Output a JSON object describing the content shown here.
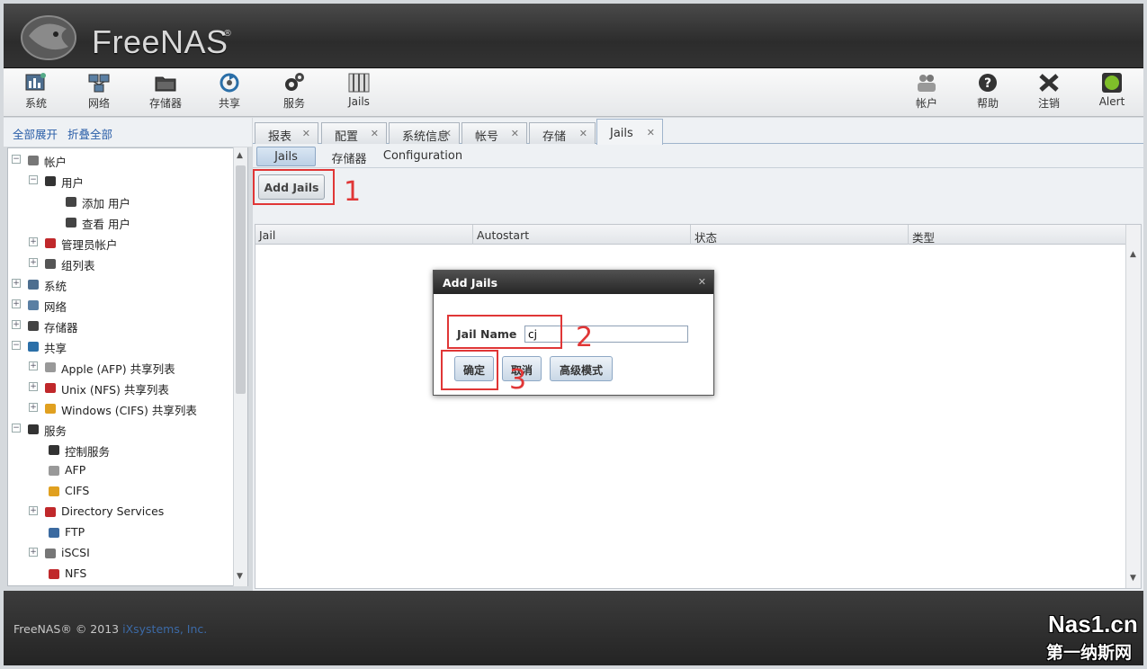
{
  "brand": {
    "logo_text": "FreeNAS",
    "registered": "®"
  },
  "toolbar": {
    "left": [
      {
        "label": "系统",
        "icon": "system-icon"
      },
      {
        "label": "网络",
        "icon": "network-icon"
      },
      {
        "label": "存储器",
        "icon": "storage-icon"
      },
      {
        "label": "共享",
        "icon": "sharing-icon"
      },
      {
        "label": "服务",
        "icon": "services-icon"
      },
      {
        "label": "Jails",
        "icon": "jails-icon"
      }
    ],
    "right": [
      {
        "label": "帐户",
        "icon": "account-icon"
      },
      {
        "label": "帮助",
        "icon": "help-icon"
      },
      {
        "label": "注销",
        "icon": "logout-icon"
      },
      {
        "label": "Alert",
        "icon": "alert-icon"
      }
    ]
  },
  "sidebar": {
    "expand_all": "全部展开",
    "collapse_all": "折叠全部",
    "tree": [
      {
        "label": "帐户",
        "expander": "-",
        "icon": "accounts-icon"
      },
      {
        "label": "用户",
        "expander": "-",
        "icon": "user-icon"
      },
      {
        "label": "添加 用户",
        "expander": "",
        "icon": "add-user-icon"
      },
      {
        "label": "查看 用户",
        "expander": "",
        "icon": "view-users-icon"
      },
      {
        "label": "管理员帐户",
        "expander": "+",
        "icon": "admin-icon"
      },
      {
        "label": "组列表",
        "expander": "+",
        "icon": "groups-icon"
      },
      {
        "label": "系统",
        "expander": "+",
        "icon": "system-icon"
      },
      {
        "label": "网络",
        "expander": "+",
        "icon": "network-icon"
      },
      {
        "label": "存储器",
        "expander": "+",
        "icon": "storage-icon"
      },
      {
        "label": "共享",
        "expander": "-",
        "icon": "sharing-icon"
      },
      {
        "label": "Apple (AFP) 共享列表",
        "expander": "+",
        "icon": "apple-icon"
      },
      {
        "label": "Unix (NFS) 共享列表",
        "expander": "+",
        "icon": "bsd-icon"
      },
      {
        "label": "Windows (CIFS) 共享列表",
        "expander": "+",
        "icon": "windows-icon"
      },
      {
        "label": "服务",
        "expander": "-",
        "icon": "services-icon"
      },
      {
        "label": "控制服务",
        "expander": "",
        "icon": "control-services-icon"
      },
      {
        "label": "AFP",
        "expander": "",
        "icon": "apple-icon"
      },
      {
        "label": "CIFS",
        "expander": "",
        "icon": "windows-icon"
      },
      {
        "label": "Directory Services",
        "expander": "+",
        "icon": "directory-icon"
      },
      {
        "label": "FTP",
        "expander": "",
        "icon": "ftp-icon"
      },
      {
        "label": "iSCSI",
        "expander": "+",
        "icon": "iscsi-icon"
      },
      {
        "label": "NFS",
        "expander": "",
        "icon": "bsd-icon"
      }
    ]
  },
  "tabs": [
    {
      "label": "报表"
    },
    {
      "label": "配置"
    },
    {
      "label": "系统信息"
    },
    {
      "label": "帐号"
    },
    {
      "label": "存储"
    },
    {
      "label": "Jails",
      "active": true
    }
  ],
  "subtabs": [
    {
      "label": "Jails",
      "active": true
    },
    {
      "label": "存储器"
    },
    {
      "label": "Configuration"
    }
  ],
  "add_jails_button": "Add Jails",
  "grid": {
    "columns": [
      "Jail",
      "Autostart",
      "状态",
      "类型"
    ]
  },
  "dialog": {
    "title": "Add Jails",
    "jail_name_label": "Jail Name",
    "jail_name_value": "cj",
    "ok": "确定",
    "cancel": "取消",
    "advanced": "高级模式"
  },
  "annotations": [
    "1",
    "2",
    "3"
  ],
  "footer": {
    "copyright": "FreeNAS® © 2013 ",
    "company": "iXsystems, Inc."
  },
  "watermark": {
    "top": "Nas1.cn",
    "bottom": "第一纳斯网"
  },
  "colors": {
    "annotation": "#e03636",
    "link": "#2a5ea8",
    "header": "#333333"
  }
}
